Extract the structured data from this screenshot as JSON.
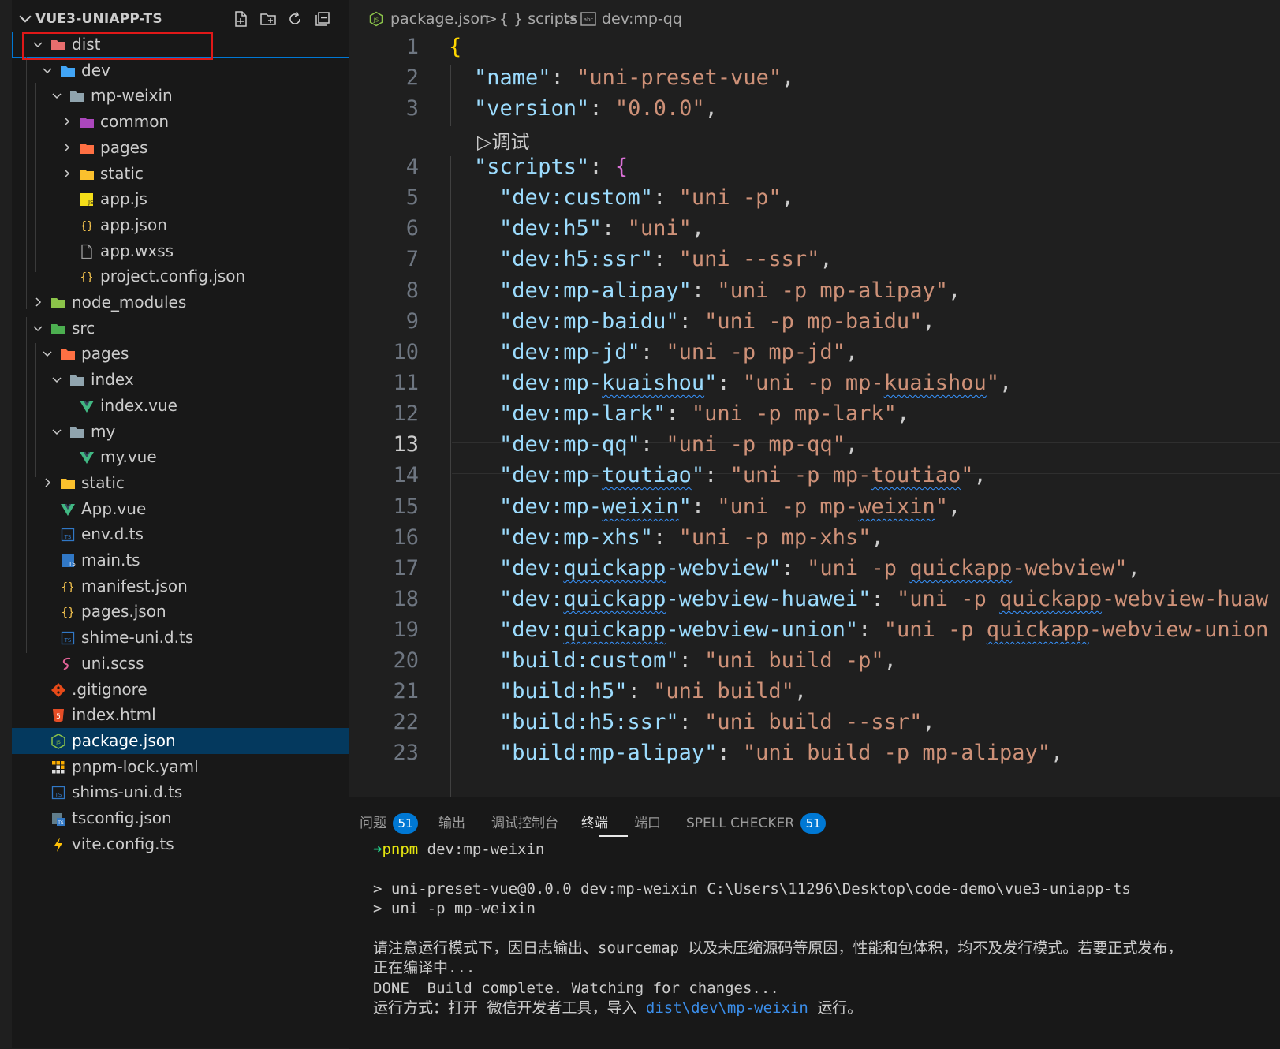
{
  "explorer": {
    "title": "VUE3-UNIAPP-TS",
    "actions": [
      "new-file",
      "new-folder",
      "refresh",
      "collapse-all"
    ],
    "items": [
      {
        "label": "dist",
        "depth": 0,
        "type": "folder-open",
        "icon": "dist-folder-icon",
        "color": "#e86d6d"
      },
      {
        "label": "dev",
        "depth": 1,
        "type": "folder-open",
        "icon": "code-folder-icon",
        "color": "#42a5f5"
      },
      {
        "label": "mp-weixin",
        "depth": 2,
        "type": "folder-open",
        "icon": "folder-icon",
        "color": "#90a4ae"
      },
      {
        "label": "common",
        "depth": 3,
        "type": "folder",
        "icon": "common-folder-icon",
        "color": "#ab47bc"
      },
      {
        "label": "pages",
        "depth": 3,
        "type": "folder",
        "icon": "pages-folder-icon",
        "color": "#ff7043"
      },
      {
        "label": "static",
        "depth": 3,
        "type": "folder",
        "icon": "static-folder-icon",
        "color": "#fbc02d"
      },
      {
        "label": "app.js",
        "depth": 3,
        "type": "file",
        "icon": "js-file-icon",
        "color": "#f5de19"
      },
      {
        "label": "app.json",
        "depth": 3,
        "type": "file",
        "icon": "json-file-icon",
        "color": "#f9c74f"
      },
      {
        "label": "app.wxss",
        "depth": 3,
        "type": "file",
        "icon": "generic-file-icon",
        "color": "#9e9e9e"
      },
      {
        "label": "project.config.json",
        "depth": 3,
        "type": "file",
        "icon": "json-file-icon",
        "color": "#f9c74f"
      },
      {
        "label": "node_modules",
        "depth": 0,
        "type": "folder",
        "icon": "node-modules-folder-icon",
        "color": "#8bc34a"
      },
      {
        "label": "src",
        "depth": 0,
        "type": "folder-open",
        "icon": "src-folder-icon",
        "color": "#4caf50"
      },
      {
        "label": "pages",
        "depth": 1,
        "type": "folder-open",
        "icon": "pages-folder-icon",
        "color": "#ff7043"
      },
      {
        "label": "index",
        "depth": 2,
        "type": "folder-open",
        "icon": "folder-icon",
        "color": "#90a4ae"
      },
      {
        "label": "index.vue",
        "depth": 3,
        "type": "file",
        "icon": "vue-file-icon",
        "color": "#41b883"
      },
      {
        "label": "my",
        "depth": 2,
        "type": "folder-open",
        "icon": "folder-icon",
        "color": "#90a4ae"
      },
      {
        "label": "my.vue",
        "depth": 3,
        "type": "file",
        "icon": "vue-file-icon",
        "color": "#41b883"
      },
      {
        "label": "static",
        "depth": 1,
        "type": "folder",
        "icon": "static-folder-icon",
        "color": "#fbc02d"
      },
      {
        "label": "App.vue",
        "depth": 1,
        "type": "file",
        "icon": "vue-file-icon",
        "color": "#41b883"
      },
      {
        "label": "env.d.ts",
        "depth": 1,
        "type": "file",
        "icon": "ts-def-file-icon",
        "color": "#3178c6"
      },
      {
        "label": "main.ts",
        "depth": 1,
        "type": "file",
        "icon": "ts-file-icon",
        "color": "#3178c6"
      },
      {
        "label": "manifest.json",
        "depth": 1,
        "type": "file",
        "icon": "json-file-icon",
        "color": "#f9c74f"
      },
      {
        "label": "pages.json",
        "depth": 1,
        "type": "file",
        "icon": "json-file-icon",
        "color": "#f9c74f"
      },
      {
        "label": "shime-uni.d.ts",
        "depth": 1,
        "type": "file",
        "icon": "ts-def-file-icon",
        "color": "#3178c6"
      },
      {
        "label": "uni.scss",
        "depth": 1,
        "type": "file",
        "icon": "sass-file-icon",
        "color": "#e06296"
      },
      {
        "label": ".gitignore",
        "depth": 0,
        "type": "file",
        "icon": "git-file-icon",
        "color": "#e64a19"
      },
      {
        "label": "index.html",
        "depth": 0,
        "type": "file",
        "icon": "html-file-icon",
        "color": "#e44d26"
      },
      {
        "label": "package.json",
        "depth": 0,
        "type": "file",
        "icon": "nodejs-file-icon",
        "color": "#8bc34a",
        "selected": true
      },
      {
        "label": "pnpm-lock.yaml",
        "depth": 0,
        "type": "file",
        "icon": "pnpm-file-icon",
        "color": "#f9ad00"
      },
      {
        "label": "shims-uni.d.ts",
        "depth": 0,
        "type": "file",
        "icon": "ts-def-file-icon",
        "color": "#3178c6"
      },
      {
        "label": "tsconfig.json",
        "depth": 0,
        "type": "file",
        "icon": "tsconfig-file-icon",
        "color": "#3178c6"
      },
      {
        "label": "vite.config.ts",
        "depth": 0,
        "type": "file",
        "icon": "vite-file-icon",
        "color": "#ffc107"
      }
    ]
  },
  "breadcrumb": {
    "file": "package.json",
    "sep": ">",
    "section": "{ } scripts",
    "leaf": "dev:mp-qq"
  },
  "editor": {
    "codelens": "▷调试",
    "active_line": 13,
    "lines": [
      {
        "n": "1",
        "key": "",
        "val": "",
        "raw": "{"
      },
      {
        "n": "2",
        "key": "\"name\"",
        "val": "\"uni-preset-vue\"",
        "end": ","
      },
      {
        "n": "3",
        "key": "\"version\"",
        "val": "\"0.0.0\"",
        "end": ","
      },
      {
        "n": "4",
        "key": "\"scripts\"",
        "val": "",
        "end": "",
        "open": "{"
      },
      {
        "n": "5",
        "key": "\"dev:custom\"",
        "val": "\"uni -p\"",
        "end": ","
      },
      {
        "n": "6",
        "key": "\"dev:h5\"",
        "val": "\"uni\"",
        "end": ","
      },
      {
        "n": "7",
        "key": "\"dev:h5:ssr\"",
        "val": "\"uni --ssr\"",
        "end": ","
      },
      {
        "n": "8",
        "key": "\"dev:mp-alipay\"",
        "val": "\"uni -p mp-alipay\"",
        "end": ","
      },
      {
        "n": "9",
        "key": "\"dev:mp-baidu\"",
        "val": "\"uni -p mp-baidu\"",
        "end": ","
      },
      {
        "n": "10",
        "key": "\"dev:mp-jd\"",
        "val": "\"uni -p mp-jd\"",
        "end": ","
      },
      {
        "n": "11",
        "key": "\"dev:mp-kuaishou\"",
        "val": "\"uni -p mp-kuaishou\"",
        "end": ","
      },
      {
        "n": "12",
        "key": "\"dev:mp-lark\"",
        "val": "\"uni -p mp-lark\"",
        "end": ","
      },
      {
        "n": "13",
        "key": "\"dev:mp-qq\"",
        "val": "\"uni -p mp-qq\"",
        "end": ","
      },
      {
        "n": "14",
        "key": "\"dev:mp-toutiao\"",
        "val": "\"uni -p mp-toutiao\"",
        "end": ","
      },
      {
        "n": "15",
        "key": "\"dev:mp-weixin\"",
        "val": "\"uni -p mp-weixin\"",
        "end": ","
      },
      {
        "n": "16",
        "key": "\"dev:mp-xhs\"",
        "val": "\"uni -p mp-xhs\"",
        "end": ","
      },
      {
        "n": "17",
        "key": "\"dev:quickapp-webview\"",
        "val": "\"uni -p quickapp-webview\"",
        "end": ","
      },
      {
        "n": "18",
        "key": "\"dev:quickapp-webview-huawei\"",
        "val": "\"uni -p quickapp-webview-huaw",
        "end": ""
      },
      {
        "n": "19",
        "key": "\"dev:quickapp-webview-union\"",
        "val": "\"uni -p quickapp-webview-union",
        "end": ""
      },
      {
        "n": "20",
        "key": "\"build:custom\"",
        "val": "\"uni build -p\"",
        "end": ","
      },
      {
        "n": "21",
        "key": "\"build:h5\"",
        "val": "\"uni build\"",
        "end": ","
      },
      {
        "n": "22",
        "key": "\"build:h5:ssr\"",
        "val": "\"uni build --ssr\"",
        "end": ","
      },
      {
        "n": "23",
        "key": "\"build:mp-alipay\"",
        "val": "\"uni build -p mp-alipay\"",
        "end": ","
      }
    ]
  },
  "panel": {
    "tabs": [
      {
        "label": "问题",
        "badge": "51"
      },
      {
        "label": "输出"
      },
      {
        "label": "调试控制台"
      },
      {
        "label": "终端",
        "active": true
      },
      {
        "label": "端口"
      },
      {
        "label": "SPELL CHECKER",
        "badge": "51"
      }
    ],
    "terminal": {
      "prompt_arrow": "➜",
      "prompt_cmd": "pnpm",
      "prompt_args": " dev:mp-weixin",
      "line2": "> uni-preset-vue@0.0.0 dev:mp-weixin C:\\Users\\11296\\Desktop\\code-demo\\vue3-uniapp-ts",
      "line3": "> uni -p mp-weixin",
      "line4": "请注意运行模式下，因日志输出、sourcemap 以及未压缩源码等原因，性能和包体积，均不及发行模式。若要正式发布，",
      "line5": "正在编译中...",
      "line6": "DONE  Build complete. Watching for changes...",
      "line7_a": "运行方式：打开 微信开发者工具，导入 ",
      "line7_link": "dist\\dev\\mp-weixin",
      "line7_b": " 运行。"
    }
  }
}
